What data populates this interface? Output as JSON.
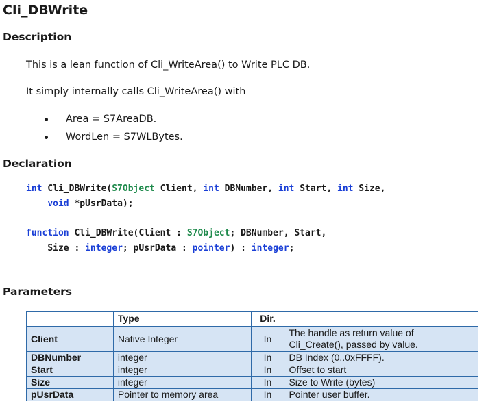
{
  "function_name": "Cli_DBWrite",
  "sections": {
    "description": "Description",
    "declaration": "Declaration",
    "parameters": "Parameters"
  },
  "description": {
    "line1": "This is a lean function of Cli_WriteArea() to Write PLC DB.",
    "line2": "It simply internally calls Cli_WriteArea() with",
    "bullets": [
      "Area = S7AreaDB.",
      "WordLen = S7WLBytes."
    ]
  },
  "declaration": {
    "c": {
      "t1": "int",
      "t2": " Cli_DBWrite(",
      "t3": "S7Object",
      "t4": " Client, ",
      "t5": "int",
      "t6": " DBNumber, ",
      "t7": "int",
      "t8": " Start, ",
      "t9": "int",
      "t10": " Size,",
      "t11": "void",
      "t12": " *pUsrData);"
    },
    "pascal": {
      "t1": "function",
      "t2": " Cli_DBWrite(Client : ",
      "t3": "S7Object",
      "t4": "; DBNumber, Start,",
      "t5": "Size : ",
      "t6": "integer",
      "t7": "; pUsrData : ",
      "t8": "pointer",
      "t9": ") : ",
      "t10": "integer",
      "t11": ";"
    }
  },
  "params_table": {
    "headers": [
      "",
      "Type",
      "Dir.",
      ""
    ],
    "rows": [
      {
        "name": "Client",
        "type": "Native Integer",
        "dir": "In",
        "desc1": "The handle as return value of",
        "desc2": "Cli_Create(), passed by value."
      },
      {
        "name": "DBNumber",
        "type": "integer",
        "dir": "In",
        "desc1": "DB Index (0..0xFFFF).",
        "desc2": ""
      },
      {
        "name": "Start",
        "type": "integer",
        "dir": "In",
        "desc1": "Offset to start",
        "desc2": ""
      },
      {
        "name": "Size",
        "type": "integer",
        "dir": "In",
        "desc1": "Size to Write (bytes)",
        "desc2": ""
      },
      {
        "name": "pUsrData",
        "type": "Pointer to memory area",
        "dir": "In",
        "desc1": "Pointer user buffer.",
        "desc2": ""
      }
    ]
  },
  "colors": {
    "keyword": "#1a3fd6",
    "type_name": "#1f8a4c",
    "table_border": "#2f6aa8",
    "table_fill": "#d6e4f4"
  }
}
